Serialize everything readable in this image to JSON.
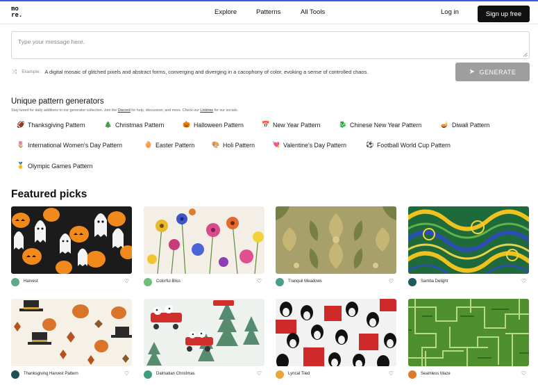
{
  "header": {
    "logo": "mo re.",
    "logo_line1": "mo",
    "logo_line2": "re.",
    "nav": [
      "Explore",
      "Patterns",
      "All Tools"
    ],
    "login": "Log in",
    "signup": "Sign up free"
  },
  "prompt": {
    "placeholder": "Type your message here.",
    "example_label": "Example:",
    "example_text": "A digital mosaic of glitched pixels and abstract forms, converging and diverging in a cacophony of color, evoking a sense of controlled chaos.",
    "generate": "GENERATE"
  },
  "generators": {
    "title": "Unique pattern generators",
    "subtitle_pre": "Stay tuned for daily additions to our generator collection. Join the ",
    "subtitle_discord": "Discord",
    "subtitle_mid": " for help, discussion, and more. Check our ",
    "subtitle_linktree": "Linktree",
    "subtitle_post": " for our socials.",
    "items": [
      {
        "icon": "🏈",
        "label": "Thanksgiving Pattern"
      },
      {
        "icon": "🎄",
        "label": "Christmas Pattern"
      },
      {
        "icon": "🎃",
        "label": "Halloween Pattern"
      },
      {
        "icon": "📅",
        "label": "New Year Pattern"
      },
      {
        "icon": "🐉",
        "label": "Chinese New Year Pattern"
      },
      {
        "icon": "🪔",
        "label": "Diwali Pattern"
      },
      {
        "icon": "🌷",
        "label": "International Women's Day Pattern"
      },
      {
        "icon": "🥚",
        "label": "Easter Pattern"
      },
      {
        "icon": "🎨",
        "label": "Holi Pattern"
      },
      {
        "icon": "💘",
        "label": "Valentine's Day Pattern"
      },
      {
        "icon": "⚽",
        "label": "Football World Cup Pattern"
      },
      {
        "icon": "🥇",
        "label": "Olympic Games Pattern"
      }
    ]
  },
  "featured": {
    "title": "Featured picks",
    "cards": [
      {
        "name": "Harvest",
        "avatar_color": "#5fa88a"
      },
      {
        "name": "Colorful Bliss",
        "avatar_color": "#6cbf7a"
      },
      {
        "name": "Tranquil Meadows",
        "avatar_color": "#4a9d8f"
      },
      {
        "name": "Samba Delight",
        "avatar_color": "#1d5c5a"
      },
      {
        "name": "Thanksgiving Harvest Pattern",
        "avatar_color": "#1e4f55"
      },
      {
        "name": "Dalmatian Christmas",
        "avatar_color": "#3f9c7f"
      },
      {
        "name": "Lyrical Tiled",
        "avatar_color": "#e8a53c"
      },
      {
        "name": "Seamless Maze",
        "avatar_color": "#e07a2a"
      }
    ],
    "heart_icon": "heart-icon"
  },
  "colors": {
    "accent_line": "#3b5bdb",
    "signup_bg": "#111111",
    "generate_bg": "#9e9e9e"
  }
}
